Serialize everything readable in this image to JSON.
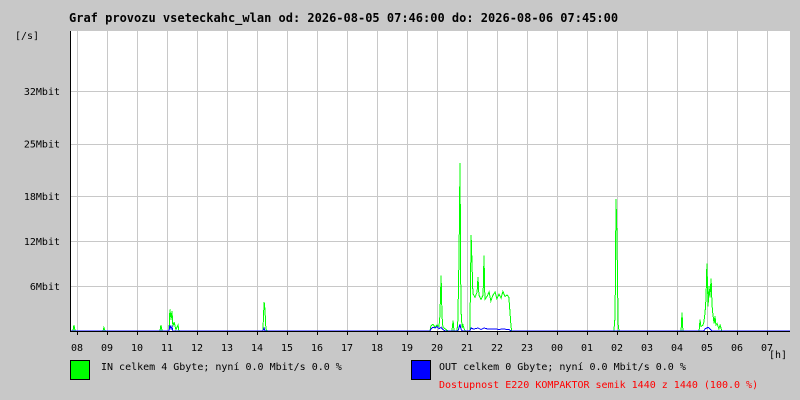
{
  "title": "Graf provozu vseteckahc_wlan od: 2026-08-05 07:46:00 do: 2026-08-06 07:45:00",
  "colors": {
    "background": "#c8c8c8",
    "plot_bg": "#ffffff",
    "grid": "#c8c8c8",
    "in": "#00ff00",
    "out": "#0000ff",
    "availability": "#ff0000"
  },
  "legend": {
    "in_text": "IN celkem 4 Gbyte; nyní   0.0 Mbit/s 0.0 %",
    "out_text": "OUT celkem 0 Gbyte; nyní   0.0 Mbit/s 0.0 %",
    "availability_text": "Dostupnost E220 KOMPAKTOR semik 1440 z 1440 (100.0 %)"
  },
  "chart_data": {
    "type": "line",
    "ylabel": "[/s]",
    "xlabel": "[h]",
    "x_unit": "hours since 07:46 (2026-08-05)",
    "xlim": [
      0,
      24
    ],
    "ylim": [
      0,
      40
    ],
    "yticks": [
      {
        "v": 6,
        "label": "6Mbit"
      },
      {
        "v": 12,
        "label": "12Mbit"
      },
      {
        "v": 18,
        "label": "18Mbit"
      },
      {
        "v": 25,
        "label": "25Mbit"
      },
      {
        "v": 32,
        "label": "32Mbit"
      }
    ],
    "xticks": [
      {
        "t": 0.233,
        "label": "08"
      },
      {
        "t": 1.233,
        "label": "09"
      },
      {
        "t": 2.233,
        "label": "10"
      },
      {
        "t": 3.233,
        "label": "11"
      },
      {
        "t": 4.233,
        "label": "12"
      },
      {
        "t": 5.233,
        "label": "13"
      },
      {
        "t": 6.233,
        "label": "14"
      },
      {
        "t": 7.233,
        "label": "15"
      },
      {
        "t": 8.233,
        "label": "16"
      },
      {
        "t": 9.233,
        "label": "17"
      },
      {
        "t": 10.233,
        "label": "18"
      },
      {
        "t": 11.233,
        "label": "19"
      },
      {
        "t": 12.233,
        "label": "20"
      },
      {
        "t": 13.233,
        "label": "21"
      },
      {
        "t": 14.233,
        "label": "22"
      },
      {
        "t": 15.233,
        "label": "23"
      },
      {
        "t": 16.233,
        "label": "00"
      },
      {
        "t": 17.233,
        "label": "01"
      },
      {
        "t": 18.233,
        "label": "02"
      },
      {
        "t": 19.233,
        "label": "03"
      },
      {
        "t": 20.233,
        "label": "04"
      },
      {
        "t": 21.233,
        "label": "05"
      },
      {
        "t": 22.233,
        "label": "06"
      },
      {
        "t": 23.233,
        "label": "07"
      }
    ],
    "grid": true,
    "series": [
      {
        "name": "IN",
        "color": "#00ff00",
        "points": [
          [
            0,
            0
          ],
          [
            0.1,
            0
          ],
          [
            0.13,
            0.8
          ],
          [
            0.17,
            0
          ],
          [
            1.1,
            0
          ],
          [
            1.13,
            0.5
          ],
          [
            1.17,
            0
          ],
          [
            3.0,
            0
          ],
          [
            3.03,
            0.8
          ],
          [
            3.07,
            0
          ],
          [
            3.3,
            0
          ],
          [
            3.33,
            2.9
          ],
          [
            3.37,
            1.5
          ],
          [
            3.4,
            2.7
          ],
          [
            3.43,
            0.6
          ],
          [
            3.47,
            1.2
          ],
          [
            3.53,
            0.2
          ],
          [
            3.6,
            0.8
          ],
          [
            3.63,
            0
          ],
          [
            6.43,
            0
          ],
          [
            6.47,
            3.9
          ],
          [
            6.5,
            2.8
          ],
          [
            6.53,
            0.3
          ],
          [
            6.57,
            0
          ],
          [
            12.0,
            0
          ],
          [
            12.03,
            0.7
          ],
          [
            12.1,
            0.9
          ],
          [
            12.17,
            0.5
          ],
          [
            12.23,
            0.8
          ],
          [
            12.3,
            0.6
          ],
          [
            12.33,
            2.0
          ],
          [
            12.37,
            7.4
          ],
          [
            12.4,
            2.0
          ],
          [
            12.43,
            0.5
          ],
          [
            12.5,
            0.3
          ],
          [
            12.6,
            0
          ],
          [
            12.73,
            0
          ],
          [
            12.77,
            1.4
          ],
          [
            12.8,
            0
          ],
          [
            12.9,
            0
          ],
          [
            12.93,
            1.5
          ],
          [
            12.97,
            10.8
          ],
          [
            13.0,
            22.4
          ],
          [
            13.03,
            3.0
          ],
          [
            13.07,
            0.4
          ],
          [
            13.1,
            0.8
          ],
          [
            13.13,
            0.4
          ],
          [
            13.17,
            0
          ],
          [
            13.33,
            0
          ],
          [
            13.37,
            12.8
          ],
          [
            13.4,
            9.0
          ],
          [
            13.43,
            5.0
          ],
          [
            13.5,
            4.5
          ],
          [
            13.57,
            5.2
          ],
          [
            13.6,
            7.2
          ],
          [
            13.63,
            4.8
          ],
          [
            13.7,
            4.2
          ],
          [
            13.77,
            4.8
          ],
          [
            13.8,
            10.1
          ],
          [
            13.83,
            4.2
          ],
          [
            13.9,
            4.6
          ],
          [
            13.97,
            5.2
          ],
          [
            14.03,
            4.0
          ],
          [
            14.1,
            4.8
          ],
          [
            14.17,
            5.2
          ],
          [
            14.23,
            4.3
          ],
          [
            14.3,
            4.9
          ],
          [
            14.37,
            4.4
          ],
          [
            14.43,
            5.3
          ],
          [
            14.5,
            4.6
          ],
          [
            14.57,
            4.8
          ],
          [
            14.63,
            4.5
          ],
          [
            14.7,
            0.6
          ],
          [
            14.73,
            0
          ],
          [
            18.13,
            0
          ],
          [
            18.17,
            2.0
          ],
          [
            18.2,
            17.6
          ],
          [
            18.23,
            13.0
          ],
          [
            18.27,
            1.0
          ],
          [
            18.3,
            0
          ],
          [
            20.37,
            0
          ],
          [
            20.4,
            2.5
          ],
          [
            20.43,
            0
          ],
          [
            20.97,
            0
          ],
          [
            21.0,
            1.5
          ],
          [
            21.03,
            0.6
          ],
          [
            21.1,
            0.8
          ],
          [
            21.13,
            1.2
          ],
          [
            21.17,
            2.5
          ],
          [
            21.2,
            4.4
          ],
          [
            21.23,
            9.0
          ],
          [
            21.27,
            3.3
          ],
          [
            21.3,
            6.0
          ],
          [
            21.33,
            4.5
          ],
          [
            21.37,
            7.0
          ],
          [
            21.4,
            3.5
          ],
          [
            21.43,
            2.2
          ],
          [
            21.47,
            1.0
          ],
          [
            21.5,
            2.0
          ],
          [
            21.53,
            0.8
          ],
          [
            21.57,
            1.0
          ],
          [
            21.63,
            0.3
          ],
          [
            21.67,
            0.8
          ],
          [
            21.73,
            0
          ]
        ]
      },
      {
        "name": "OUT",
        "color": "#0000ff",
        "points": [
          [
            0,
            0
          ],
          [
            3.3,
            0
          ],
          [
            3.33,
            0.8
          ],
          [
            3.37,
            0.3
          ],
          [
            3.4,
            0.6
          ],
          [
            3.43,
            0
          ],
          [
            6.43,
            0
          ],
          [
            6.47,
            0.4
          ],
          [
            6.5,
            0
          ],
          [
            12.0,
            0
          ],
          [
            12.03,
            0.3
          ],
          [
            12.1,
            0.5
          ],
          [
            12.17,
            0.4
          ],
          [
            12.23,
            0.6
          ],
          [
            12.3,
            0.3
          ],
          [
            12.37,
            0.5
          ],
          [
            12.43,
            0.2
          ],
          [
            12.5,
            0
          ],
          [
            12.93,
            0
          ],
          [
            12.97,
            0.5
          ],
          [
            13.0,
            0.9
          ],
          [
            13.03,
            0.3
          ],
          [
            13.07,
            0
          ],
          [
            13.33,
            0
          ],
          [
            13.37,
            0.4
          ],
          [
            13.43,
            0.3
          ],
          [
            13.5,
            0.3
          ],
          [
            13.6,
            0.4
          ],
          [
            13.7,
            0.2
          ],
          [
            13.8,
            0.4
          ],
          [
            13.9,
            0.3
          ],
          [
            14.03,
            0.3
          ],
          [
            14.17,
            0.3
          ],
          [
            14.3,
            0.2
          ],
          [
            14.43,
            0.3
          ],
          [
            14.57,
            0.2
          ],
          [
            14.63,
            0.2
          ],
          [
            14.7,
            0
          ],
          [
            21.13,
            0
          ],
          [
            21.17,
            0.3
          ],
          [
            21.27,
            0.5
          ],
          [
            21.33,
            0.3
          ],
          [
            21.4,
            0
          ],
          [
            24,
            0
          ]
        ]
      }
    ]
  }
}
